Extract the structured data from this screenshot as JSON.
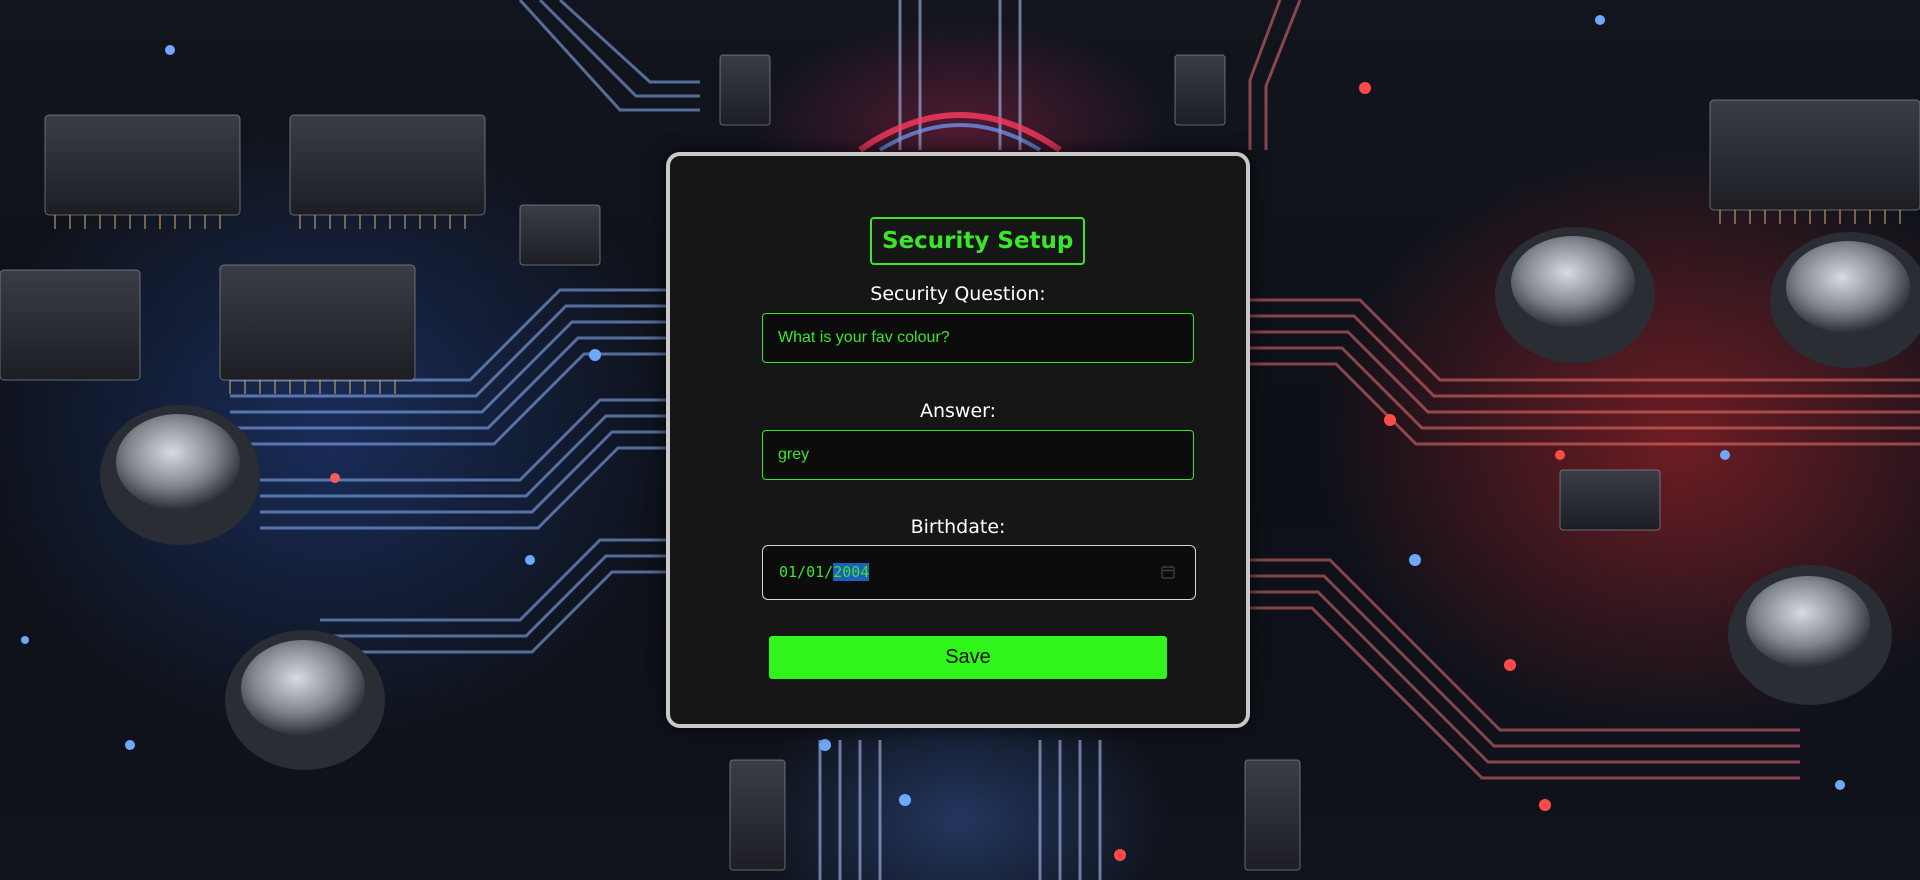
{
  "form": {
    "title": "Security Setup",
    "question_label": "Security Question:",
    "question_value": "What is your fav colour?",
    "answer_label": "Answer:",
    "answer_value": "grey",
    "birthdate_label": "Birthdate:",
    "birthdate": {
      "month": "01",
      "day": "01",
      "year": "2004",
      "separator": "/",
      "selected_segment": "year"
    },
    "save_label": "Save"
  },
  "colors": {
    "accent_green": "#39e629",
    "button_green": "#2ff51a",
    "card_bg": "#161616",
    "card_border": "#c9c9c9",
    "selection_blue": "#1f5fbf"
  },
  "icons": {
    "date_picker": "calendar-icon"
  }
}
